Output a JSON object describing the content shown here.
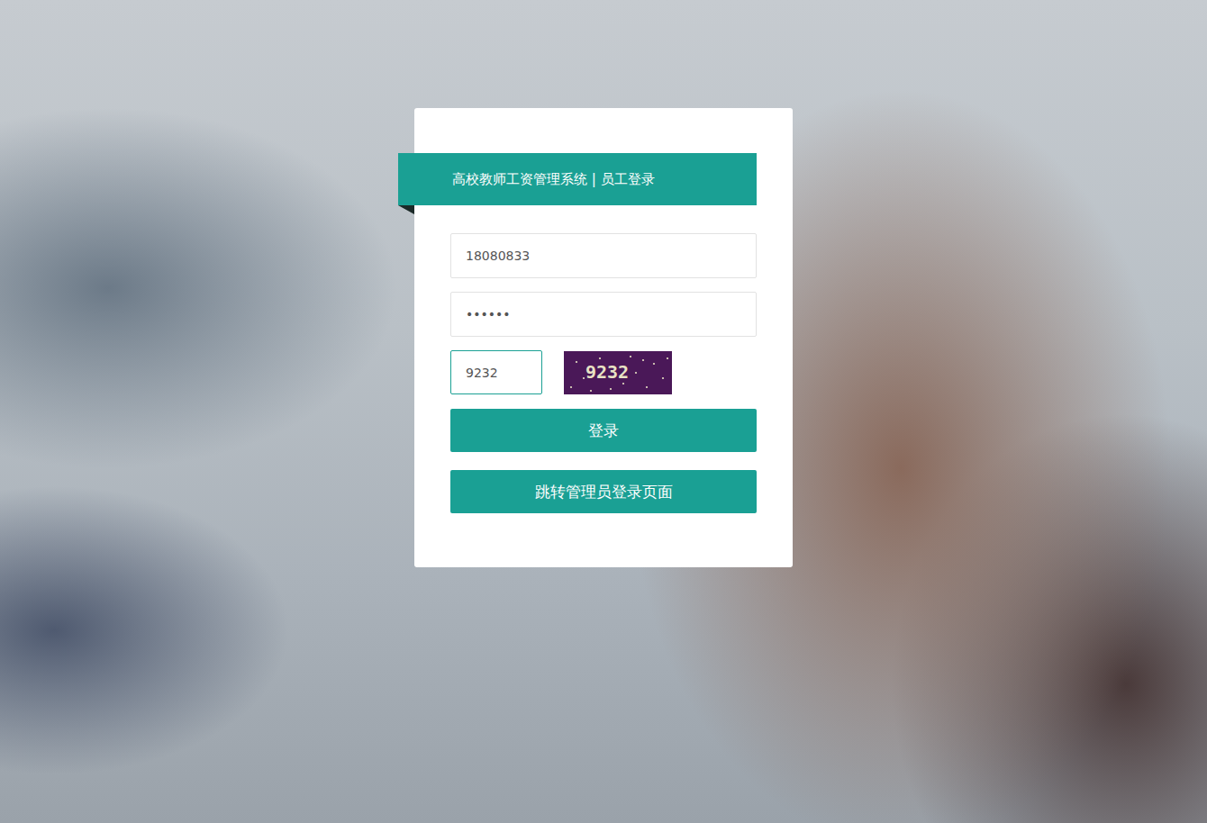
{
  "header": {
    "title": "高校教师工资管理系统 | 员工登录"
  },
  "fields": [
    {
      "name": "username",
      "value": "18080833",
      "focused": false
    },
    {
      "name": "password",
      "value": "••••••",
      "focused": false
    }
  ],
  "captcha": {
    "value": "9232",
    "focused": true,
    "image_text": "9232"
  },
  "buttons": [
    {
      "label": "登录"
    },
    {
      "label": "跳转管理员登录页面"
    }
  ]
}
